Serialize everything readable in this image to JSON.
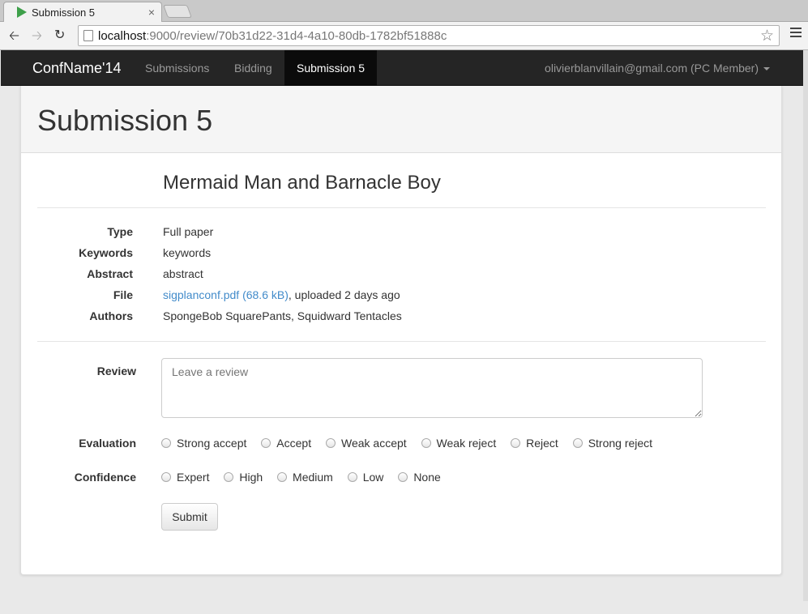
{
  "browser": {
    "tab_title": "Submission 5",
    "tab_close": "×",
    "url_host": "localhost",
    "url_rest": ":9000/review/70b31d22-31d4-4a10-80db-1782bf51888c",
    "icons": [
      "play-favicon-icon",
      "back-icon",
      "forward-icon",
      "reload-icon",
      "page-icon",
      "star-icon",
      "menu-icon"
    ]
  },
  "navbar": {
    "brand": "ConfName'14",
    "items": [
      {
        "label": "Submissions",
        "active": false
      },
      {
        "label": "Bidding",
        "active": false
      },
      {
        "label": "Submission 5",
        "active": true
      }
    ],
    "user": "olivierblanvillain@gmail.com (PC Member)"
  },
  "page": {
    "title": "Submission 5",
    "paper_title": "Mermaid Man and Barnacle Boy",
    "details": [
      {
        "label": "Type",
        "value": "Full paper"
      },
      {
        "label": "Keywords",
        "value": "keywords"
      },
      {
        "label": "Abstract",
        "value": "abstract"
      },
      {
        "label": "File",
        "link": "sigplanconf.pdf (68.6 kB)",
        "value": ", uploaded 2 days ago"
      },
      {
        "label": "Authors",
        "value": "SpongeBob SquarePants, Squidward Tentacles"
      }
    ]
  },
  "form": {
    "review_label": "Review",
    "review_placeholder": "Leave a review",
    "evaluation_label": "Evaluation",
    "evaluation_options": [
      "Strong accept",
      "Accept",
      "Weak accept",
      "Weak reject",
      "Reject",
      "Strong reject"
    ],
    "confidence_label": "Confidence",
    "confidence_options": [
      "Expert",
      "High",
      "Medium",
      "Low",
      "None"
    ],
    "submit_label": "Submit"
  },
  "colors": {
    "link": "#428bca",
    "navbar": "#252525",
    "active_nav": "#0b0b0b"
  }
}
